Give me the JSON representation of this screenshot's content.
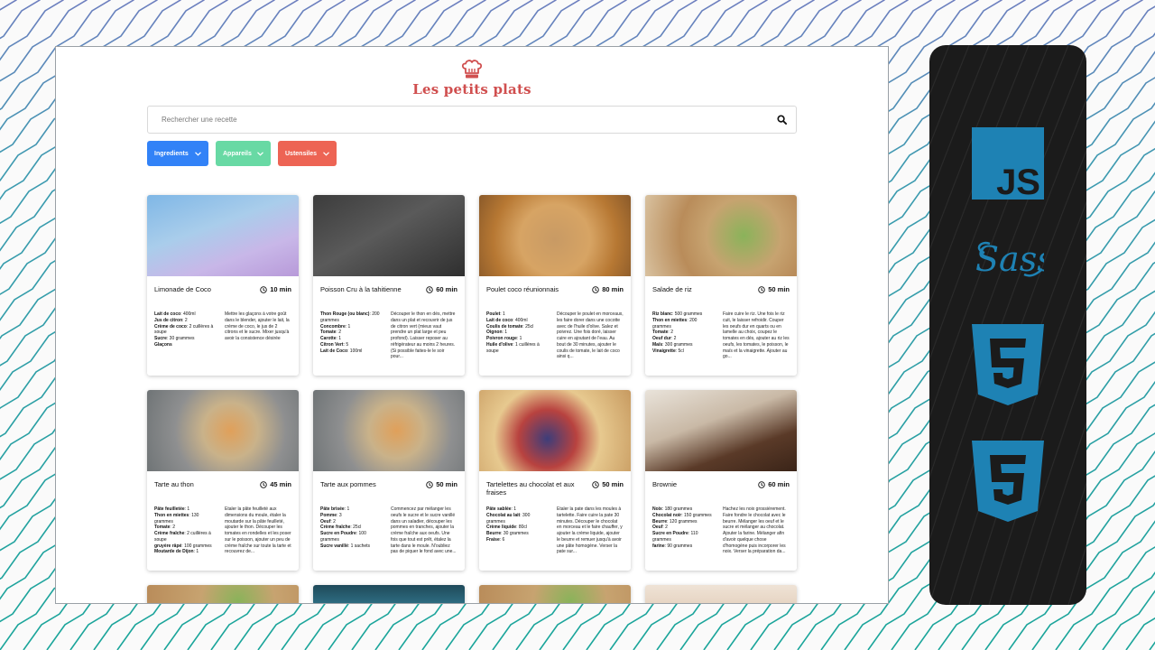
{
  "brand": {
    "name": "Les petits plats"
  },
  "search": {
    "placeholder": "Rechercher une recette"
  },
  "filters": [
    {
      "label": "Ingredients",
      "color": "#3282f7"
    },
    {
      "label": "Appareils",
      "color": "#68d9a4"
    },
    {
      "label": "Ustensiles",
      "color": "#ed6454"
    }
  ],
  "recipes": [
    {
      "title": "Limonade de Coco",
      "time": "10 min",
      "ingredients": [
        {
          "name": "Lait de coco",
          "qty": ": 400ml"
        },
        {
          "name": "Jus de citron",
          "qty": ": 2"
        },
        {
          "name": "Crème de coco",
          "qty": ": 2 cuillères à soupe"
        },
        {
          "name": "Sucre",
          "qty": ": 30 grammes"
        },
        {
          "name": "Glaçons",
          "qty": ""
        }
      ],
      "description": "Mettre les glaçons à votre goût dans le blender, ajouter le lait, la crème de coco, le jus de 2 citrons et le sucre. Mixer jusqu'à avoir la consistence désirée"
    },
    {
      "title": "Poisson Cru à la tahitienne",
      "time": "60 min",
      "ingredients": [
        {
          "name": "Thon Rouge (ou blanc)",
          "qty": ": 200 grammes"
        },
        {
          "name": "Concombre",
          "qty": ": 1"
        },
        {
          "name": "Tomate",
          "qty": ": 2"
        },
        {
          "name": "Carotte",
          "qty": ": 1"
        },
        {
          "name": "Citron Vert",
          "qty": ": 5"
        },
        {
          "name": "Lait de Coco",
          "qty": ": 100ml"
        }
      ],
      "description": "Découper le thon en dés, mettre dans un plat et recouvrir de jus de citron vert (mieux vaut prendre un plat large et peu profond). Laisser reposer au réfrigérateur au moins 2 heures. (Si possible faites-le le soir pour..."
    },
    {
      "title": "Poulet coco réunionnais",
      "time": "80 min",
      "ingredients": [
        {
          "name": "Poulet",
          "qty": ": 1"
        },
        {
          "name": "Lait de coco",
          "qty": ": 400ml"
        },
        {
          "name": "Coulis de tomate",
          "qty": ": 25cl"
        },
        {
          "name": "Oignon",
          "qty": ": 1"
        },
        {
          "name": "Poivron rouge",
          "qty": ": 1"
        },
        {
          "name": "Huile d'olive",
          "qty": ": 1 cuillères à soupe"
        }
      ],
      "description": "Découper le poulet en morceaux, les faire dorer dans une cocotte avec de l'huile d'olive. Salez et poivrez. Une fois doré, laisser cuire en ajoutant de l'eau. Au bout de 30 minutes, ajouter le coulis de tomate, le lait de coco ainsi q..."
    },
    {
      "title": "Salade de riz",
      "time": "50 min",
      "ingredients": [
        {
          "name": "Riz blanc",
          "qty": ": 500 grammes"
        },
        {
          "name": "Thon en miettes",
          "qty": ": 200 grammes"
        },
        {
          "name": "Tomate",
          "qty": ": 2"
        },
        {
          "name": "Oeuf dur",
          "qty": ": 2"
        },
        {
          "name": "Maïs",
          "qty": ": 300 grammes"
        },
        {
          "name": "Vinaigrette",
          "qty": ": 5cl"
        }
      ],
      "description": "Faire cuire le riz. Une fois le riz cuit, le laisser refroidir. Couper les oeufs dur en quarts ou en lamelle au choix, coupez le tomates en dés, ajouter au riz les oeufs, les tomates, le poisson, le maïs et la vinaigrette. Ajouter au go..."
    },
    {
      "title": "Tarte au thon",
      "time": "45 min",
      "ingredients": [
        {
          "name": "Pâte feuilletée",
          "qty": ": 1"
        },
        {
          "name": "Thon en miettes",
          "qty": ": 130 grammes"
        },
        {
          "name": "Tomate",
          "qty": ": 2"
        },
        {
          "name": "Crème fraîche",
          "qty": ": 2 cuillères à soupe"
        },
        {
          "name": "gruyère râpé",
          "qty": ": 100 grammes"
        },
        {
          "name": "Moutarde de Dijon",
          "qty": ": 1"
        }
      ],
      "description": "Etaler la pâte feuilleté aux dimensions du moule, étaler la moutarde sur la pâte feuilleté, ajouter le thon. Découper les tomates en rondelles et les poser sur le poisson, ajouter un peu de crème fraîche sur toute la tarte et recouvrez de..."
    },
    {
      "title": "Tarte aux pommes",
      "time": "50 min",
      "ingredients": [
        {
          "name": "Pâte brisée",
          "qty": ": 1"
        },
        {
          "name": "Pomme",
          "qty": ": 3"
        },
        {
          "name": "Oeuf",
          "qty": ": 2"
        },
        {
          "name": "Crème fraîche",
          "qty": ": 25cl"
        },
        {
          "name": "Sucre en Poudre",
          "qty": ": 100 grammes"
        },
        {
          "name": "Sucre vanillé",
          "qty": ": 1 sachets"
        }
      ],
      "description": "Commencez par mélanger les oeufs le sucre et le sucre vanillé dans un saladier, découper les pommes en tranches, ajouter la crème fraîche aux oeufs. Une fois que tout est prêt, étalez la tarte dans le moule. N'oubliez pas de piquer le fond avec une..."
    },
    {
      "title": "Tartelettes au chocolat et aux fraises",
      "time": "50 min",
      "ingredients": [
        {
          "name": "Pâte sablée",
          "qty": ": 1"
        },
        {
          "name": "Chocolat au lait",
          "qty": ": 300 grammes"
        },
        {
          "name": "Crème liquide",
          "qty": ": 80cl"
        },
        {
          "name": "Beurre",
          "qty": ": 30 grammes"
        },
        {
          "name": "Fraise",
          "qty": ": 6"
        }
      ],
      "description": "Etaler la pate dans les moules à tartelette. Faire cuire la pate 30 minutes. Découper le chocolat en morceau et le faire chauffer, y ajouter la crème liquide, ajouter le beurre et remuer jusqu'à avoir une pâte homogène. Verser la pate sur..."
    },
    {
      "title": "Brownie",
      "time": "60 min",
      "ingredients": [
        {
          "name": "Noix",
          "qty": ": 180 grammes"
        },
        {
          "name": "Chocolat noir",
          "qty": ": 150 grammes"
        },
        {
          "name": "Beurre",
          "qty": ": 120 grammes"
        },
        {
          "name": "Oeuf",
          "qty": ": 2"
        },
        {
          "name": "Sucre en Poudre",
          "qty": ": 110 grammes"
        },
        {
          "name": "farine",
          "qty": ": 90 grammes"
        }
      ],
      "description": "Hachez les noix grossièrement. Faire fondre le chocolat avec le beurre. Mélanger les oeuf et le sucre et mélanger au chocolat. Ajouter la farine. Mélanger afin d'avoir quelque chose d'homogène puis incorporer les noix. Verser la préparation da..."
    }
  ],
  "colors": {
    "brand": "#d04f4f",
    "panel": "#1b1b1b",
    "logo_blue": "#1e82b4"
  },
  "side_logos": [
    "js-icon",
    "sass-icon",
    "html5-icon",
    "css3-icon"
  ]
}
